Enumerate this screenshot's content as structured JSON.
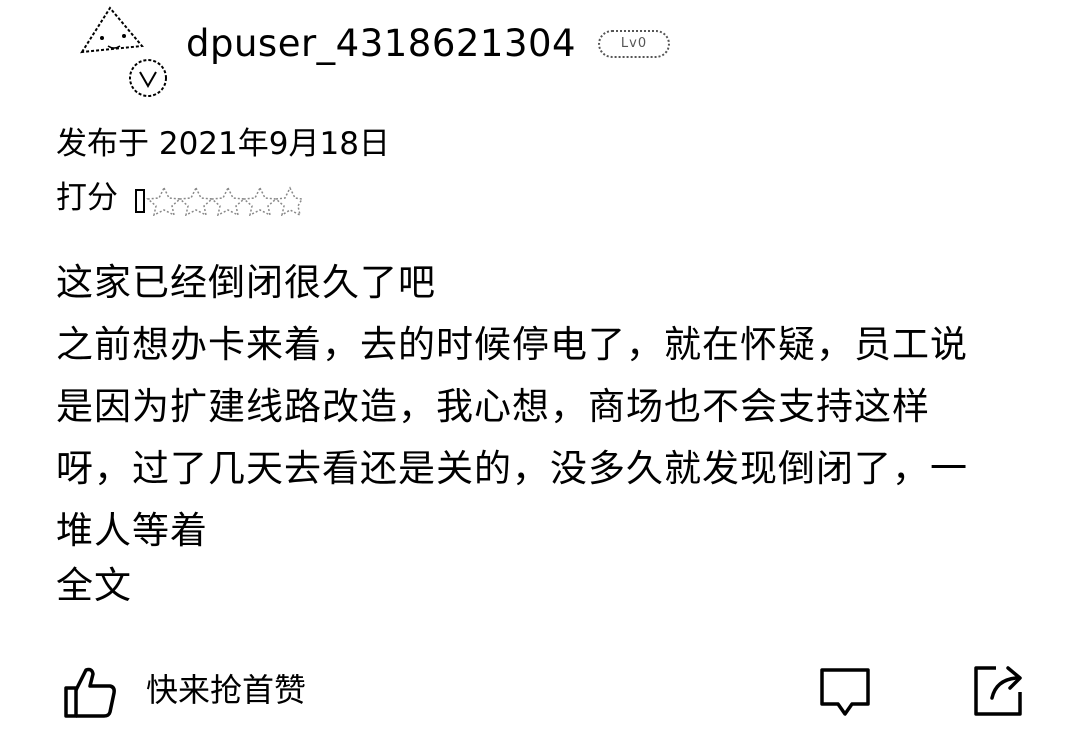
{
  "user": {
    "username": "dpuser_4318621304",
    "level_badge": "Lv0",
    "avatar_icon": "default-avatar-icon"
  },
  "meta": {
    "published": "发布于 2021年9月18日",
    "rating_label": "打分",
    "rating_icon": "star-rating-icon"
  },
  "review": {
    "lines": [
      "这家已经倒闭很久了吧",
      "之前想办卡来着，去的时候停电了，就在怀疑，员工说是因为扩建线路改造，我心想，商场也不会支持这样呀，过了几天去看还是关的，没多久就发现倒闭了，一堆人等着"
    ],
    "read_more": "全文"
  },
  "actions": {
    "like_label": "快来抢首赞",
    "like_icon": "thumbs-up-icon",
    "comment_icon": "comment-icon",
    "share_icon": "share-icon"
  }
}
